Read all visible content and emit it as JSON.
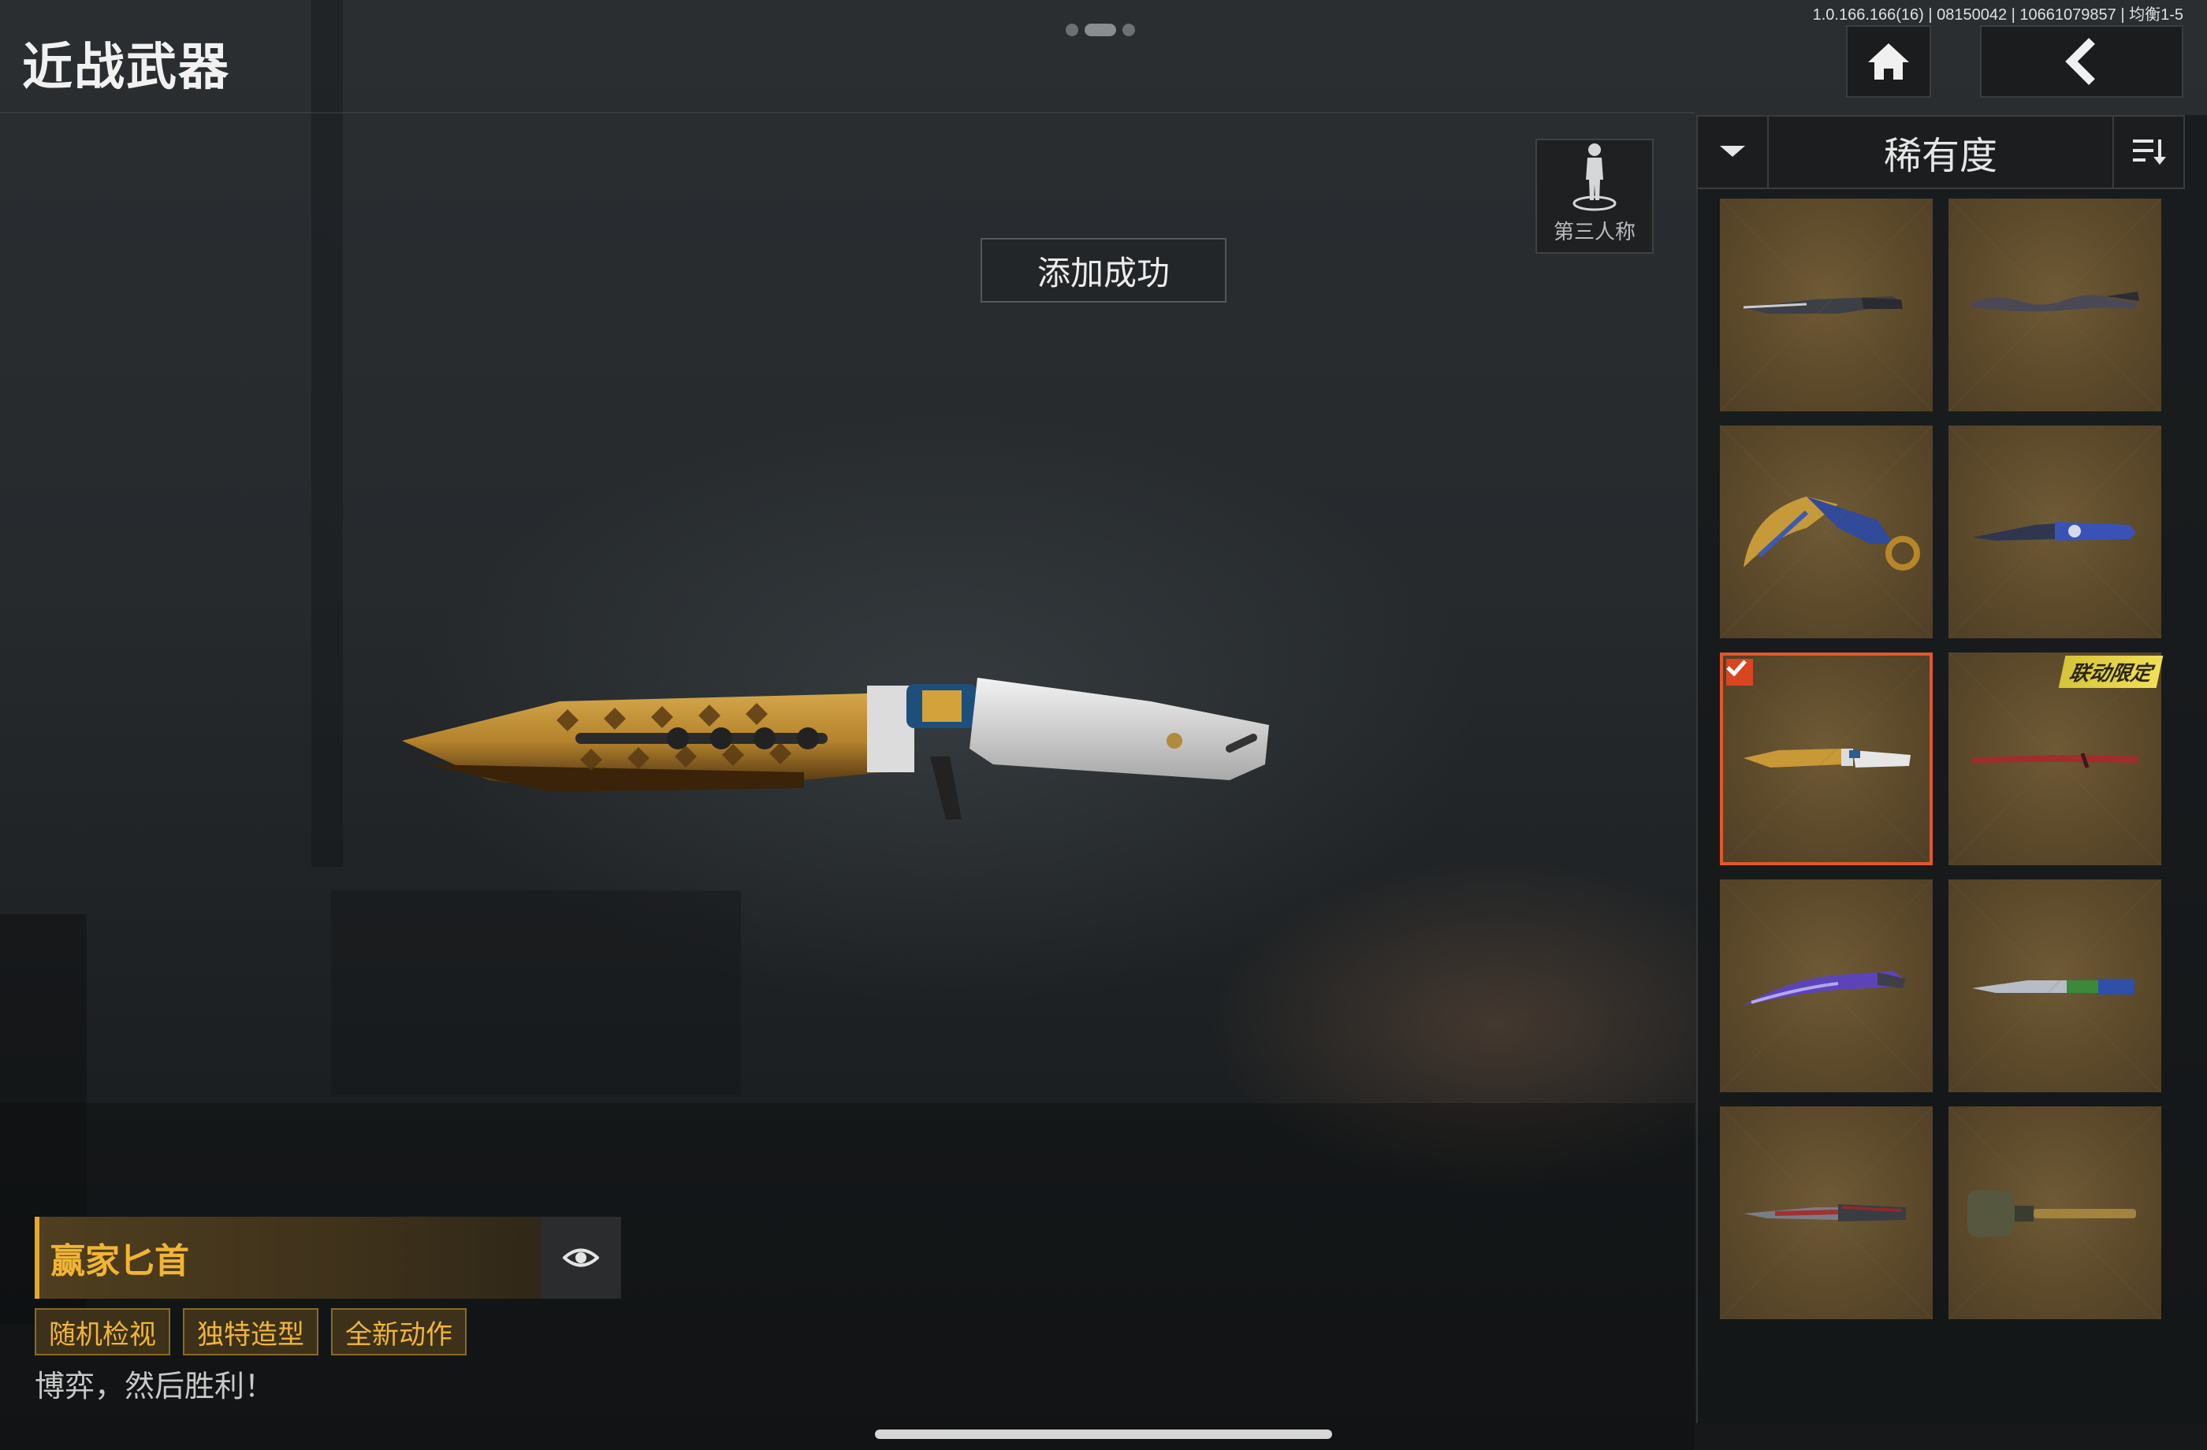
{
  "header": {
    "title": "近战武器",
    "version_info": "1.0.166.166(16) | 08150042 | 10661079857 | 均衡1-5",
    "home_icon": "home-icon",
    "back_icon": "chevron-left-icon"
  },
  "toast": {
    "message": "添加成功"
  },
  "view_toggle": {
    "label": "第三人称",
    "icon": "third-person-icon"
  },
  "sort": {
    "label": "稀有度",
    "dropdown_icon": "chevron-down-icon",
    "order_icon": "sort-order-icon"
  },
  "weapon_grid": {
    "items": [
      {
        "icon": "serrated-dark-knife-icon",
        "selected": false
      },
      {
        "icon": "wavy-blade-knife-icon",
        "selected": false
      },
      {
        "icon": "gold-karambit-icon",
        "selected": false
      },
      {
        "icon": "blue-tactical-knife-icon",
        "selected": false
      },
      {
        "icon": "gold-dagger-icon",
        "selected": true
      },
      {
        "icon": "red-katana-icon",
        "selected": false,
        "badge": "联动限定"
      },
      {
        "icon": "purple-curved-blade-icon",
        "selected": false
      },
      {
        "icon": "steel-combat-knife-icon",
        "selected": false
      },
      {
        "icon": "red-bayonet-icon",
        "selected": false
      },
      {
        "icon": "shovel-icon",
        "selected": false
      }
    ]
  },
  "selected_weapon": {
    "name": "赢家匕首",
    "tags": [
      "随机检视",
      "独特造型",
      "全新动作"
    ],
    "slogan": "博弈，然后胜利！",
    "preview_icon": "eye-icon"
  },
  "colors": {
    "accent_gold": "#f2b533",
    "selection_red": "#e2572b",
    "collab_badge": "#e6d44c"
  }
}
